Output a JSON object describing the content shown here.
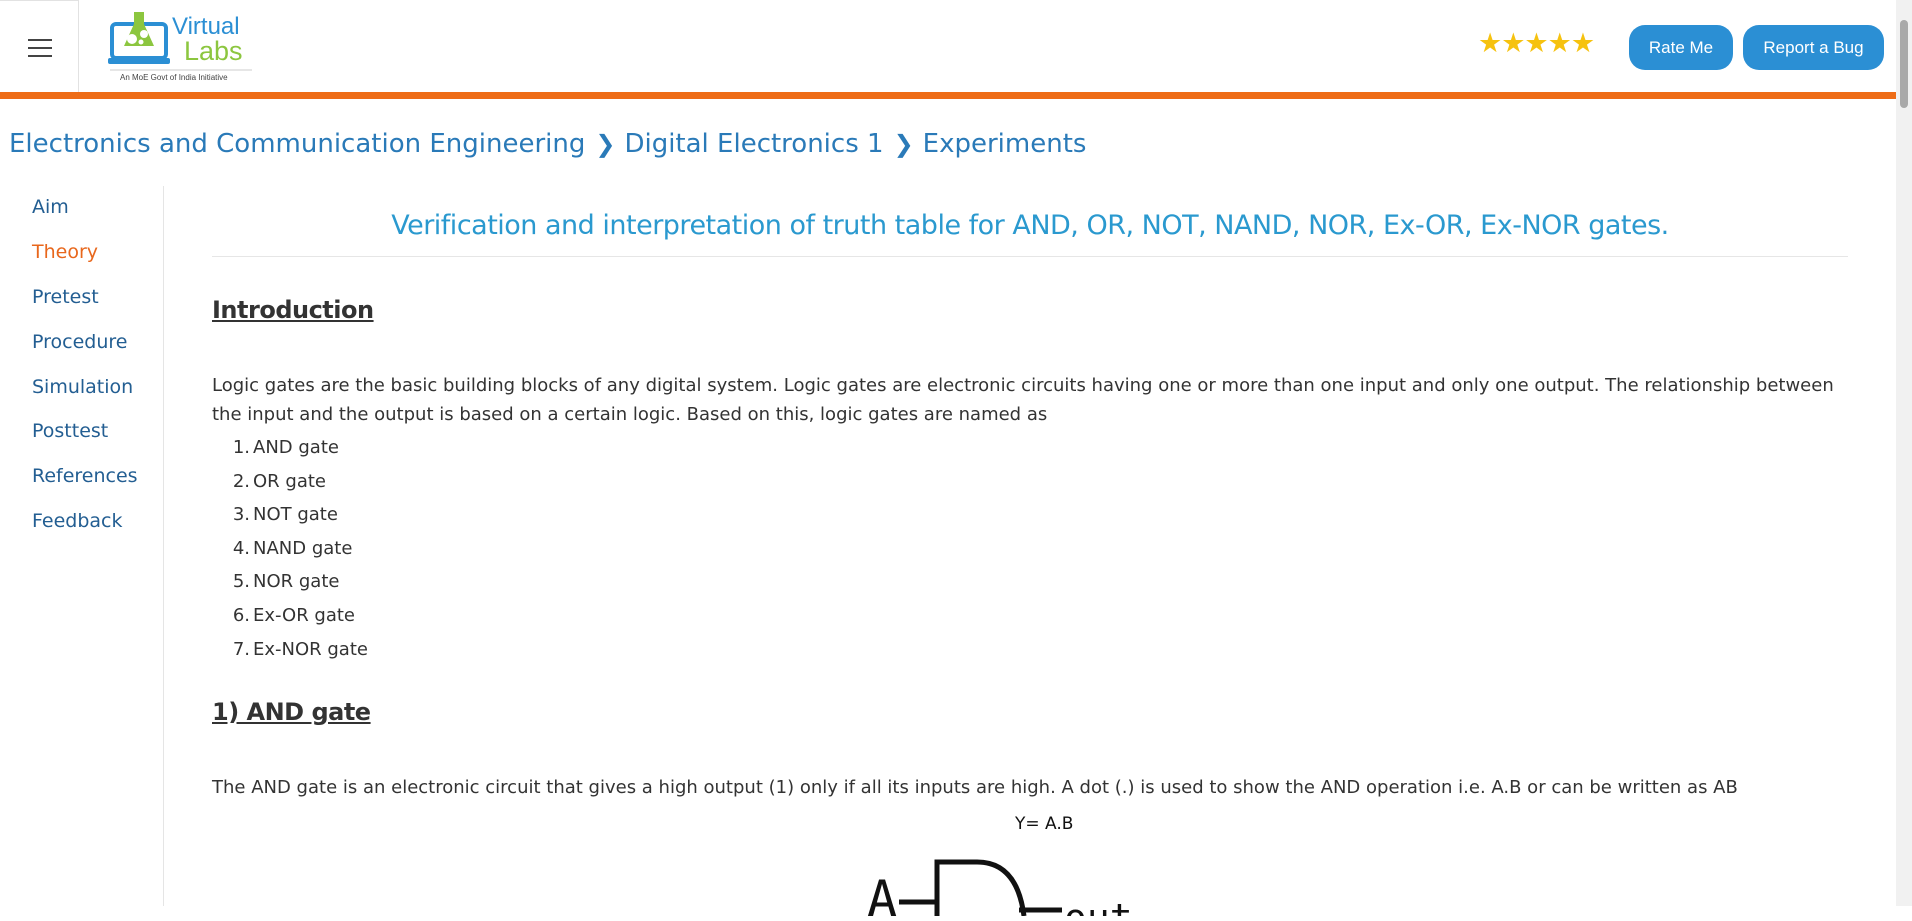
{
  "header": {
    "logo": {
      "line1": "Virtual",
      "line2": "Labs",
      "tagline": "An MoE Govt of India Initiative"
    },
    "rating_stars": "★★★★★",
    "rate_button": "Rate Me",
    "bug_button": "Report a Bug",
    "accent_color": "#ee6c16",
    "button_color": "#2b8fd4"
  },
  "breadcrumb": [
    "Electronics and Communication Engineering",
    "Digital Electronics 1",
    "Experiments"
  ],
  "sidebar": {
    "items": [
      "Aim",
      "Theory",
      "Pretest",
      "Procedure",
      "Simulation",
      "Posttest",
      "References",
      "Feedback"
    ],
    "active": "Theory"
  },
  "content": {
    "title": "Verification and interpretation of truth table for AND, OR, NOT, NAND, NOR, Ex-OR, Ex-NOR gates.",
    "intro_heading": "Introduction",
    "intro_text": "Logic gates are the basic building blocks of any digital system. Logic gates are electronic circuits having one or more than one input and only one output. The relationship between the input and the output is based on a certain logic. Based on this, logic gates are named as",
    "gates": [
      "AND gate",
      "OR gate",
      "NOT gate",
      "NAND gate",
      "NOR gate",
      "Ex-OR gate",
      "Ex-NOR gate"
    ],
    "and_heading": "1) AND gate",
    "and_text": "The AND gate is an electronic circuit that gives a high output (1) only if all its inputs are high. A dot (.) is used to show the AND operation i.e. A.B or can be written as AB",
    "diagram": {
      "equation": "Y= A.B",
      "input_a": "A",
      "output": "out"
    }
  }
}
